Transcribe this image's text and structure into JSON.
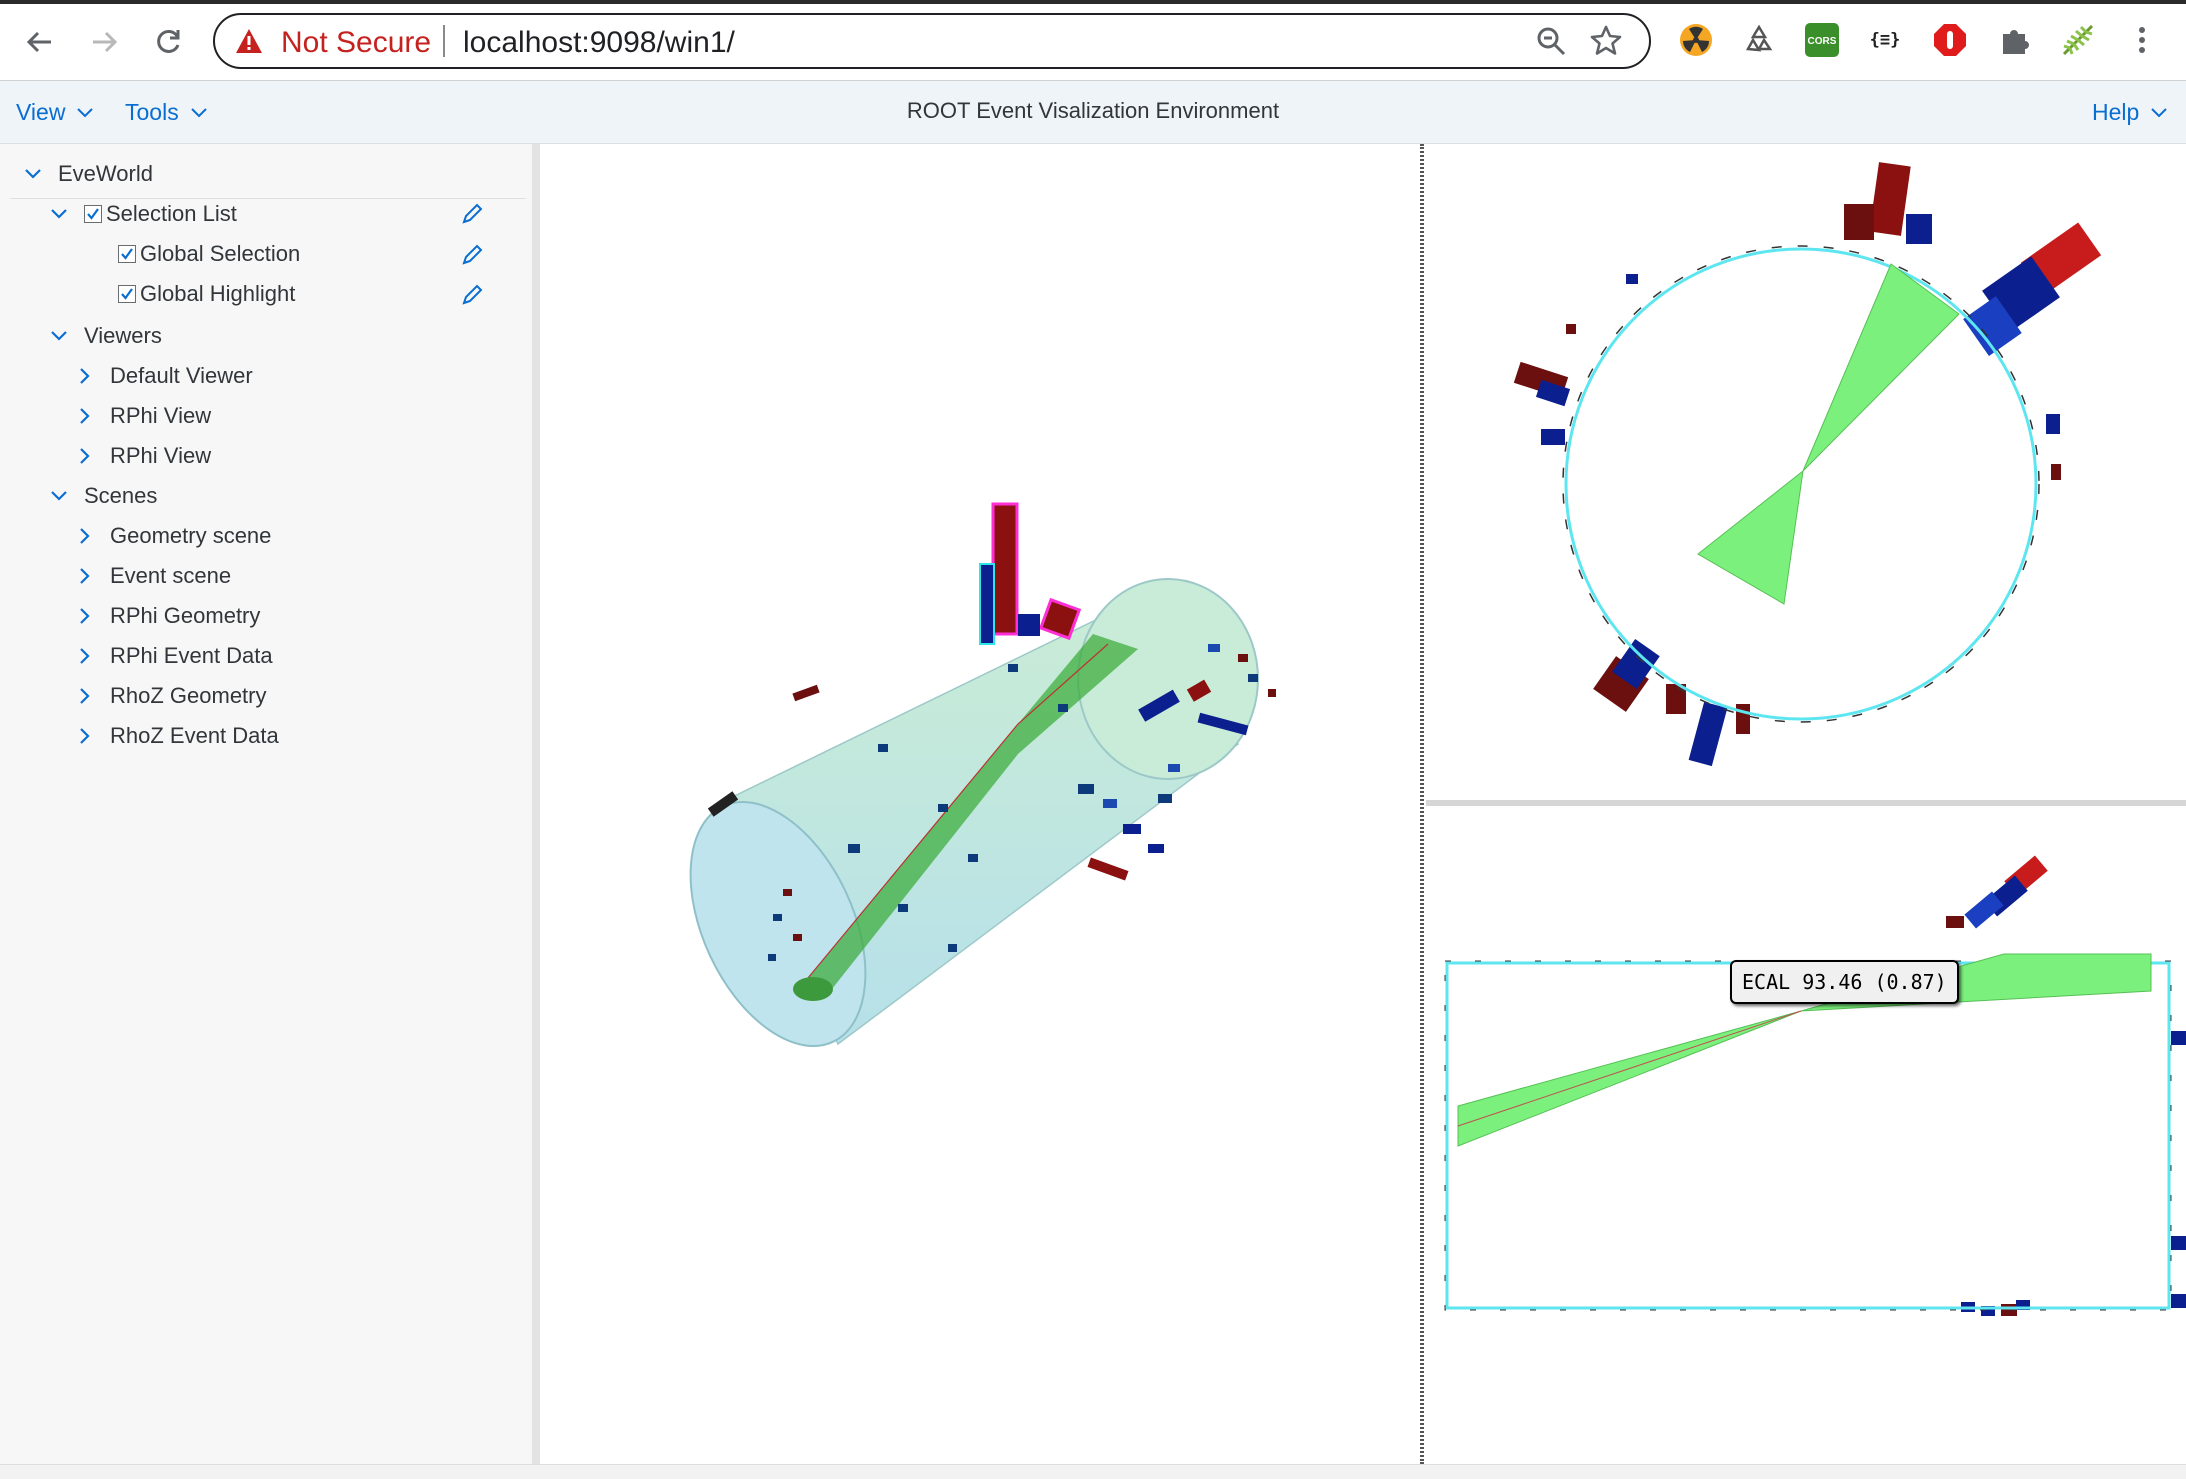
{
  "browser": {
    "security_label": "Not Secure",
    "url": "localhost:9098/win1/",
    "extensions": [
      "radiation-extension-icon",
      "recycle-extension-icon",
      "cors-extension-icon",
      "json-extension-icon",
      "adblock-extension-icon",
      "puzzle-extensions-icon",
      "fern-extension-icon"
    ],
    "cors_label": "CORS",
    "json_label": "{≡}"
  },
  "header": {
    "menu_view": "View",
    "menu_tools": "Tools",
    "title": "ROOT Event Visalization Environment",
    "menu_help": "Help"
  },
  "tree": {
    "root": "EveWorld",
    "selection_list": "Selection List",
    "global_selection": "Global Selection",
    "global_highlight": "Global Highlight",
    "viewers": "Viewers",
    "default_viewer": "Default Viewer",
    "rphi_view_1": "RPhi View",
    "rphi_view_2": "RPhi View",
    "scenes": "Scenes",
    "geometry_scene": "Geometry scene",
    "event_scene": "Event scene",
    "rphi_geometry": "RPhi Geometry",
    "rphi_event_data": "RPhi Event Data",
    "rhoz_geometry": "RhoZ Geometry",
    "rhoz_event_data": "RhoZ Event Data"
  },
  "tooltip": {
    "text": "ECAL 93.46 (0.87)"
  },
  "colors": {
    "accent": "#0a6ed1",
    "jet": "#7cf07c",
    "ecal": "#8b1010",
    "hcal": "#0b1f8f",
    "highlight": "#ff00ff",
    "outline": "#5ee6f0"
  }
}
